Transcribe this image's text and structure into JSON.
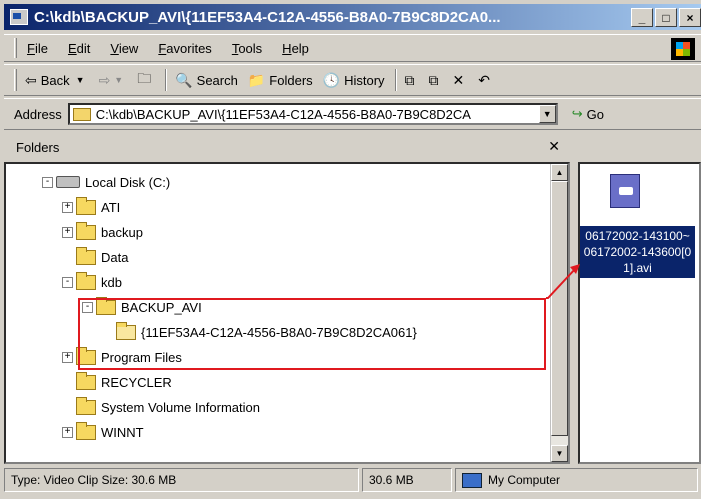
{
  "window": {
    "title": "C:\\kdb\\BACKUP_AVI\\{11EF53A4-C12A-4556-B8A0-7B9C8D2CA0...",
    "buttons": [
      "_",
      "□",
      "×"
    ]
  },
  "menu": [
    "File",
    "Edit",
    "View",
    "Favorites",
    "Tools",
    "Help"
  ],
  "toolbar": {
    "back": "Back",
    "search": "Search",
    "folders": "Folders",
    "history": "History"
  },
  "address": {
    "label": "Address",
    "value": "C:\\kdb\\BACKUP_AVI\\{11EF53A4-C12A-4556-B8A0-7B9C8D2CA",
    "go": "Go"
  },
  "folders_pane": {
    "title": "Folders",
    "tree": [
      {
        "label": "Local Disk (C:)",
        "type": "drive",
        "expander": "-"
      },
      {
        "label": "ATI",
        "type": "folder",
        "expander": "+"
      },
      {
        "label": "backup",
        "type": "folder",
        "expander": "+"
      },
      {
        "label": "Data",
        "type": "folder",
        "expander": ""
      },
      {
        "label": "kdb",
        "type": "folder",
        "expander": "-"
      },
      {
        "label": "BACKUP_AVI",
        "type": "folder",
        "expander": "-"
      },
      {
        "label": "{11EF53A4-C12A-4556-B8A0-7B9C8D2CA061}",
        "type": "folder-open",
        "expander": ""
      },
      {
        "label": "Program Files",
        "type": "folder",
        "expander": "+"
      },
      {
        "label": "RECYCLER",
        "type": "folder",
        "expander": ""
      },
      {
        "label": "System Volume Information",
        "type": "folder",
        "expander": ""
      },
      {
        "label": "WINNT",
        "type": "folder",
        "expander": "+"
      }
    ]
  },
  "file": {
    "name": "06172002-143100~06172002-143600[01].avi"
  },
  "status": {
    "type_size": "Type: Video Clip Size: 30.6 MB",
    "size": "30.6 MB",
    "zone": "My Computer"
  },
  "colors": {
    "highlight": "#e0191f",
    "selection": "#0a246a",
    "titlebar_start": "#0a246a"
  }
}
